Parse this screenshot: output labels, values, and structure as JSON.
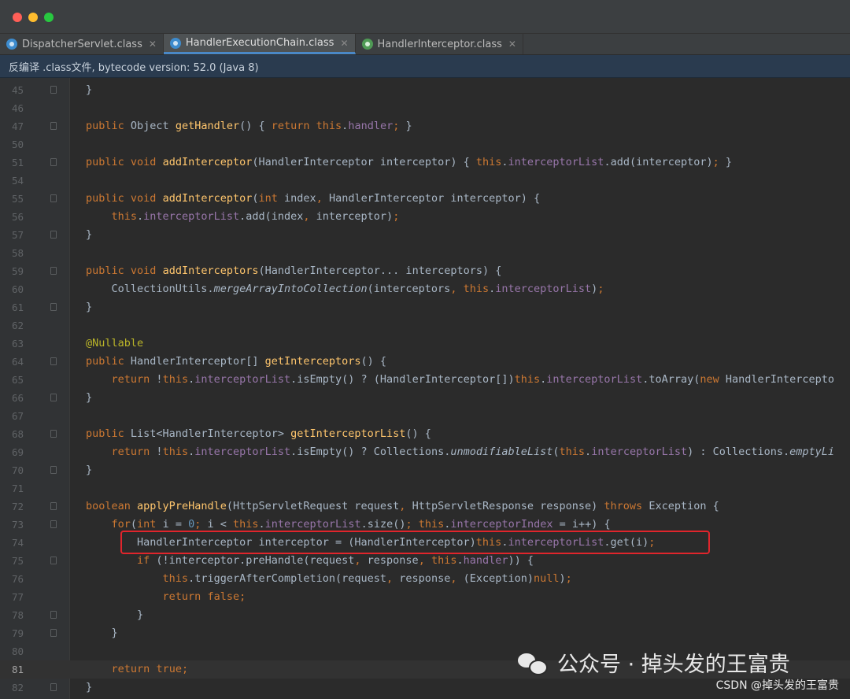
{
  "window": {
    "tabs": [
      {
        "label": "DispatcherServlet.class",
        "active": false,
        "icon": "class-file-icon"
      },
      {
        "label": "HandlerExecutionChain.class",
        "active": true,
        "icon": "class-file-icon"
      },
      {
        "label": "HandlerInterceptor.class",
        "active": false,
        "icon": "interface-file-icon"
      }
    ],
    "banner": "反编译 .class文件, bytecode version: 52.0 (Java 8)"
  },
  "code_lines": [
    {
      "n": "45",
      "text": "    }"
    },
    {
      "n": "46",
      "text": ""
    },
    {
      "n": "47",
      "text": "    public Object getHandler() { return this.handler; }"
    },
    {
      "n": "50",
      "text": ""
    },
    {
      "n": "51",
      "text": "    public void addInterceptor(HandlerInterceptor interceptor) { this.interceptorList.add(interceptor); }"
    },
    {
      "n": "54",
      "text": ""
    },
    {
      "n": "55",
      "text": "    public void addInterceptor(int index, HandlerInterceptor interceptor) {"
    },
    {
      "n": "56",
      "text": "        this.interceptorList.add(index, interceptor);"
    },
    {
      "n": "57",
      "text": "    }"
    },
    {
      "n": "58",
      "text": ""
    },
    {
      "n": "59",
      "text": "    public void addInterceptors(HandlerInterceptor... interceptors) {"
    },
    {
      "n": "60",
      "text": "        CollectionUtils.mergeArrayIntoCollection(interceptors, this.interceptorList);"
    },
    {
      "n": "61",
      "text": "    }"
    },
    {
      "n": "62",
      "text": ""
    },
    {
      "n": "63",
      "text": "    @Nullable"
    },
    {
      "n": "64",
      "text": "    public HandlerInterceptor[] getInterceptors() {"
    },
    {
      "n": "65",
      "text": "        return !this.interceptorList.isEmpty() ? (HandlerInterceptor[])this.interceptorList.toArray(new HandlerIntercepto"
    },
    {
      "n": "66",
      "text": "    }"
    },
    {
      "n": "67",
      "text": ""
    },
    {
      "n": "68",
      "text": "    public List<HandlerInterceptor> getInterceptorList() {"
    },
    {
      "n": "69",
      "text": "        return !this.interceptorList.isEmpty() ? Collections.unmodifiableList(this.interceptorList) : Collections.emptyLi"
    },
    {
      "n": "70",
      "text": "    }"
    },
    {
      "n": "71",
      "text": ""
    },
    {
      "n": "72",
      "text": "    boolean applyPreHandle(HttpServletRequest request, HttpServletResponse response) throws Exception {"
    },
    {
      "n": "73",
      "text": "        for(int i = 0; i < this.interceptorList.size(); this.interceptorIndex = i++) {"
    },
    {
      "n": "74",
      "text": "            HandlerInterceptor interceptor = (HandlerInterceptor)this.interceptorList.get(i);"
    },
    {
      "n": "75",
      "text": "            if (!interceptor.preHandle(request, response, this.handler)) {"
    },
    {
      "n": "76",
      "text": "                this.triggerAfterCompletion(request, response, (Exception)null);"
    },
    {
      "n": "77",
      "text": "                return false;"
    },
    {
      "n": "78",
      "text": "            }"
    },
    {
      "n": "79",
      "text": "        }"
    },
    {
      "n": "80",
      "text": ""
    },
    {
      "n": "81",
      "text": "        return true;"
    },
    {
      "n": "82",
      "text": "    }"
    }
  ],
  "watermark": {
    "brand": "公众号 · 掉头发的王富贵",
    "csdn": "CSDN @掉头发的王富贵"
  },
  "colors": {
    "keyword": "#cc7832",
    "method": "#ffc66d",
    "field": "#9876aa",
    "annotation": "#bbb529",
    "number": "#6897bb",
    "text": "#a9b7c6",
    "highlight_box": "#e0252c"
  }
}
